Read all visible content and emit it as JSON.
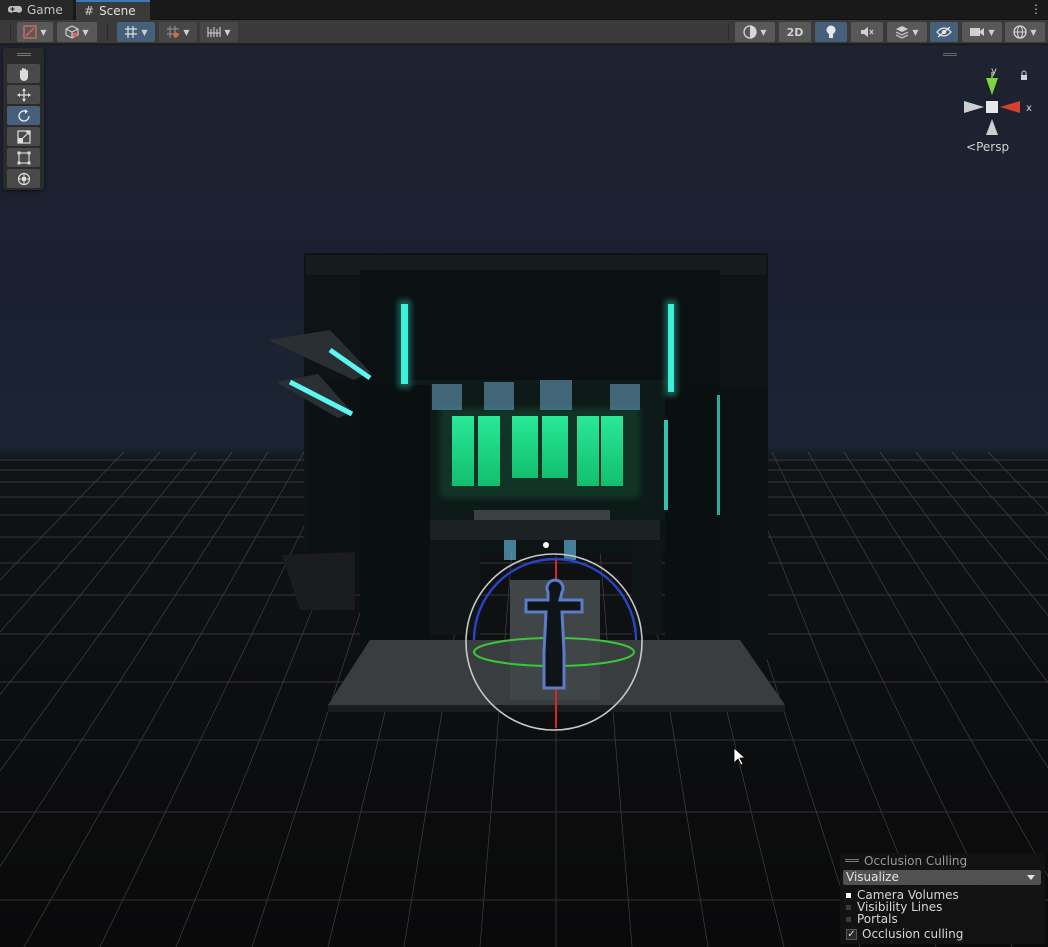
{
  "tabs": [
    {
      "label": "Game",
      "icon": "gamepad-icon"
    },
    {
      "label": "Scene",
      "icon": "hash-icon"
    }
  ],
  "toolbar": {
    "two_d_label": "2D"
  },
  "gizmo": {
    "y_label": "y",
    "x_label": "x",
    "persp_label": "Persp"
  },
  "occlusion": {
    "title": "Occlusion Culling",
    "mode": "Visualize",
    "items": [
      "Camera Volumes",
      "Visibility Lines",
      "Portals"
    ],
    "checkbox_label": "Occlusion culling",
    "checkbox_checked": true
  },
  "colors": {
    "accent": "#46607c",
    "tab_highlight": "#3a79bb",
    "neon_cyan": "#3af0d8",
    "neon_green": "#2cf08c",
    "gizmo_red": "#d6402e",
    "gizmo_green": "#7ed33c"
  }
}
